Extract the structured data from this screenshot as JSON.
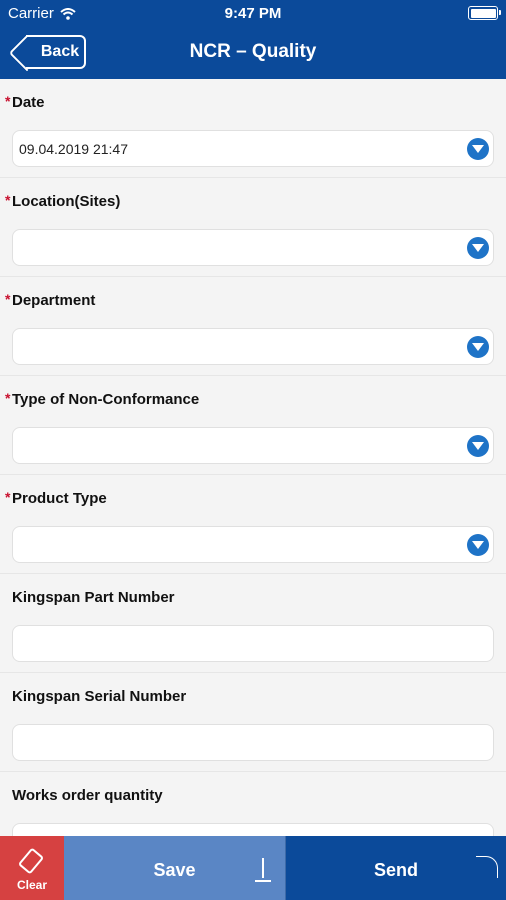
{
  "status_bar": {
    "carrier": "Carrier",
    "time": "9:47 PM"
  },
  "nav": {
    "back_label": "Back",
    "title": "NCR – Quality"
  },
  "fields": [
    {
      "label": "Date",
      "required": true,
      "value": "09.04.2019 21:47",
      "dropdown": true
    },
    {
      "label": "Location(Sites)",
      "required": true,
      "value": "",
      "dropdown": true
    },
    {
      "label": "Department",
      "required": true,
      "value": "",
      "dropdown": true
    },
    {
      "label": "Type of Non-Conformance",
      "required": true,
      "value": "",
      "dropdown": true
    },
    {
      "label": "Product Type",
      "required": true,
      "value": "",
      "dropdown": true
    },
    {
      "label": "Kingspan Part Number",
      "required": false,
      "value": "",
      "dropdown": false
    },
    {
      "label": "Kingspan Serial Number",
      "required": false,
      "value": "",
      "dropdown": false
    },
    {
      "label": "Works order quantity",
      "required": false,
      "value": "",
      "dropdown": false
    }
  ],
  "required_marker": "*",
  "toolbar": {
    "clear_label": "Clear",
    "save_label": "Save",
    "send_label": "Send"
  },
  "colors": {
    "header": "#0b4a9a",
    "clear": "#d64141",
    "save": "#5a86c5",
    "send": "#0b4a9a",
    "dropdown_icon": "#1e73c7",
    "required": "#c8102e"
  }
}
